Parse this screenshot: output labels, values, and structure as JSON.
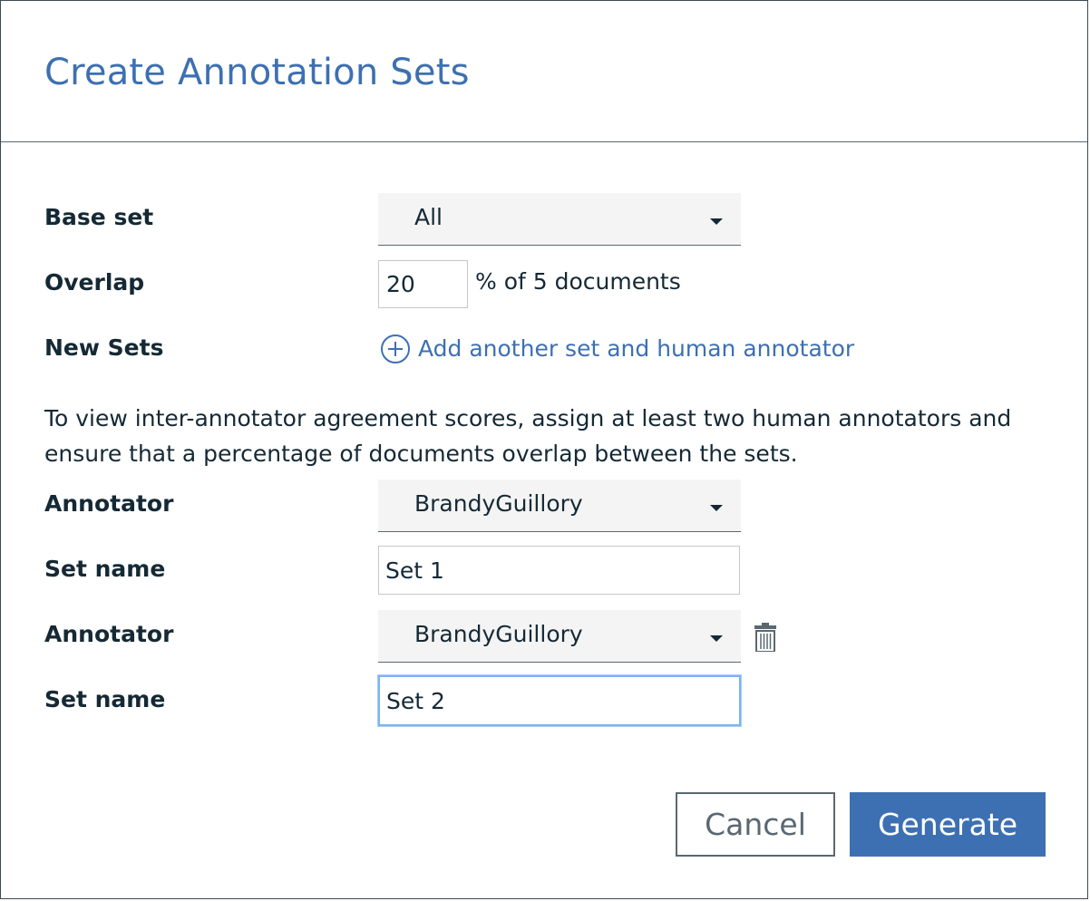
{
  "dialog": {
    "title": "Create Annotation Sets"
  },
  "form": {
    "base_set": {
      "label": "Base set",
      "value": "All"
    },
    "overlap": {
      "label": "Overlap",
      "value": "20",
      "suffix": "% of 5 documents"
    },
    "new_sets": {
      "label": "New Sets",
      "add_link": "Add another set and human annotator"
    },
    "info_text": "To view inter-annotator agreement scores, assign at least two human annotators and ensure that a percentage of documents overlap between the sets.",
    "sets": [
      {
        "annotator_label": "Annotator",
        "annotator_value": "BrandyGuillory",
        "set_name_label": "Set name",
        "set_name_value": "Set 1"
      },
      {
        "annotator_label": "Annotator",
        "annotator_value": "BrandyGuillory",
        "set_name_label": "Set name",
        "set_name_value": "Set 2"
      }
    ]
  },
  "buttons": {
    "cancel": "Cancel",
    "generate": "Generate"
  },
  "colors": {
    "accent": "#3d70b2",
    "text": "#152935",
    "secondary": "#5a6872",
    "field_bg": "#f4f4f4"
  },
  "icons": {
    "add": "plus-circle-icon",
    "caret": "caret-down-icon",
    "delete": "trash-icon"
  }
}
